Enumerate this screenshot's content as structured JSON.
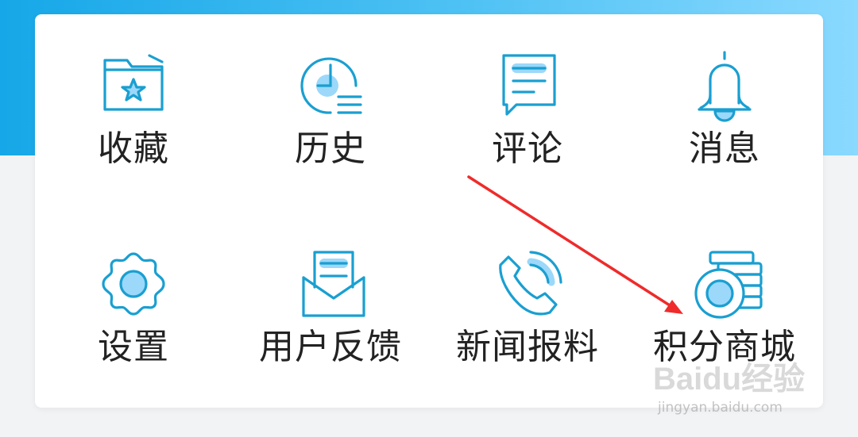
{
  "menu": {
    "row1": [
      {
        "label": "收藏",
        "icon": "favorites-folder-star-icon"
      },
      {
        "label": "历史",
        "icon": "history-clock-icon"
      },
      {
        "label": "评论",
        "icon": "comment-bubble-icon"
      },
      {
        "label": "消息",
        "icon": "message-bell-icon"
      }
    ],
    "row2": [
      {
        "label": "设置",
        "icon": "settings-gear-icon"
      },
      {
        "label": "用户反馈",
        "icon": "feedback-envelope-icon"
      },
      {
        "label": "新闻报料",
        "icon": "news-tip-phone-icon"
      },
      {
        "label": "积分商城",
        "icon": "points-mall-coins-icon"
      }
    ]
  },
  "watermark": {
    "brand": "Baidu经验",
    "url": "jingyan.baidu.com"
  },
  "colors": {
    "header_gradient_start": "#16a7e8",
    "header_gradient_end": "#8ad9ff",
    "icon_stroke": "#1a9fd1",
    "icon_fill": "#9cd8fa",
    "annotation_arrow": "#ef2b2b",
    "label_text": "#222222"
  }
}
